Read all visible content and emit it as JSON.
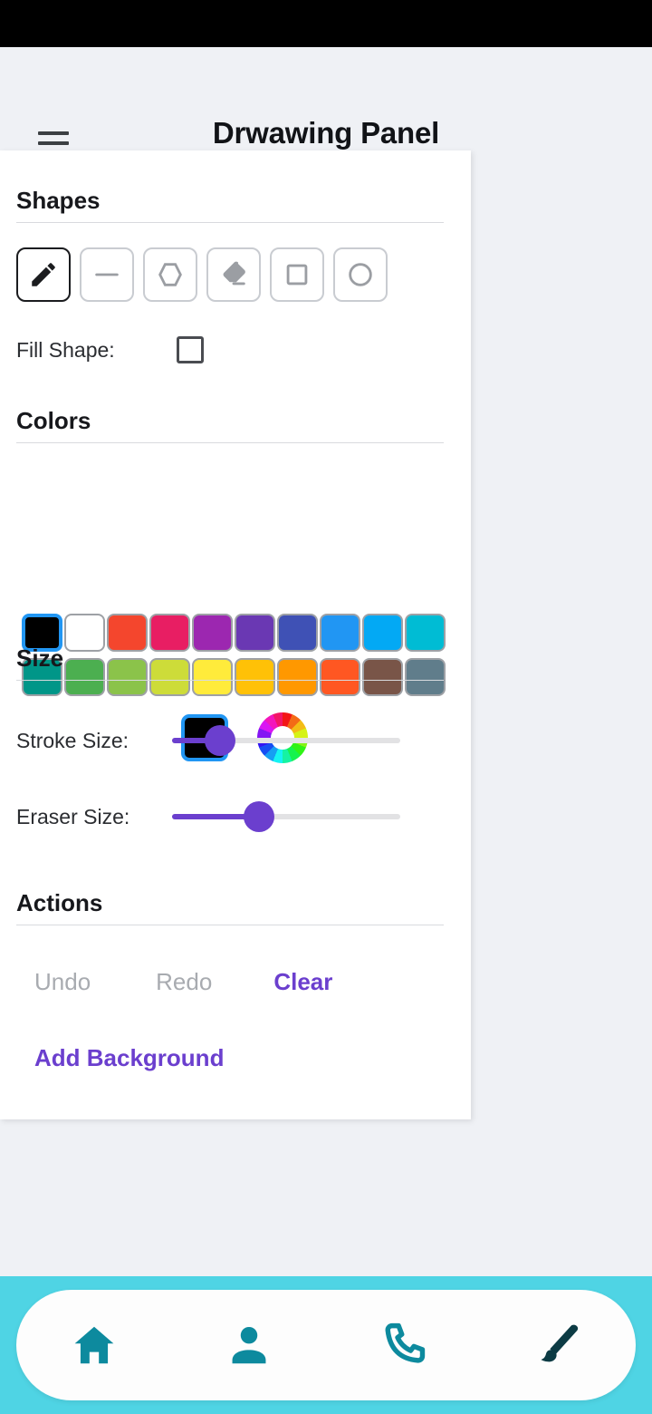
{
  "app": {
    "title": "Drwawing Panel",
    "menu_icon": "hamburger-menu-icon"
  },
  "panel": {
    "shapes": {
      "heading": "Shapes",
      "tools": [
        {
          "name": "pencil",
          "icon": "pencil-icon",
          "selected": true
        },
        {
          "name": "line",
          "icon": "line-icon",
          "selected": false
        },
        {
          "name": "polygon",
          "icon": "hexagon-icon",
          "selected": false
        },
        {
          "name": "eraser",
          "icon": "eraser-icon",
          "selected": false
        },
        {
          "name": "rectangle",
          "icon": "square-icon",
          "selected": false
        },
        {
          "name": "circle",
          "icon": "circle-icon",
          "selected": false
        }
      ],
      "fill_shape_label": "Fill Shape:",
      "fill_shape_checked": false
    },
    "colors": {
      "heading": "Colors",
      "row1": [
        "#000000",
        "#ffffff",
        "#f4462d",
        "#e81e63",
        "#9c27b0",
        "#6a38b3",
        "#3f51b5",
        "#2196f3",
        "#03a9f4",
        "#00bcd4"
      ],
      "row2": [
        "#009688",
        "#4caf50",
        "#8bc34a",
        "#cddc39",
        "#ffeb3b",
        "#ffc107",
        "#ff9800",
        "#ff5722",
        "#795548",
        "#607d8b"
      ],
      "selected_index": 0,
      "current_color": "#000000",
      "color_wheel_icon": "color-wheel-icon"
    },
    "size": {
      "heading": "Size",
      "stroke": {
        "label": "Stroke Size:",
        "percent": 21
      },
      "eraser": {
        "label": "Eraser Size:",
        "percent": 38
      }
    },
    "actions": {
      "heading": "Actions",
      "undo": {
        "label": "Undo",
        "enabled": false
      },
      "redo": {
        "label": "Redo",
        "enabled": false
      },
      "clear": {
        "label": "Clear",
        "enabled": true
      },
      "add_background": {
        "label": "Add Background",
        "enabled": true
      }
    }
  },
  "bottom_nav": {
    "background": "#4fd4e4",
    "items": [
      {
        "name": "home",
        "icon": "home-icon",
        "active": false
      },
      {
        "name": "profile",
        "icon": "person-icon",
        "active": false
      },
      {
        "name": "calls",
        "icon": "phone-icon",
        "active": false
      },
      {
        "name": "draw",
        "icon": "paintbrush-icon",
        "active": true
      }
    ],
    "icon_color": "#0d8a9e",
    "active_icon_color": "#0c3b44"
  }
}
